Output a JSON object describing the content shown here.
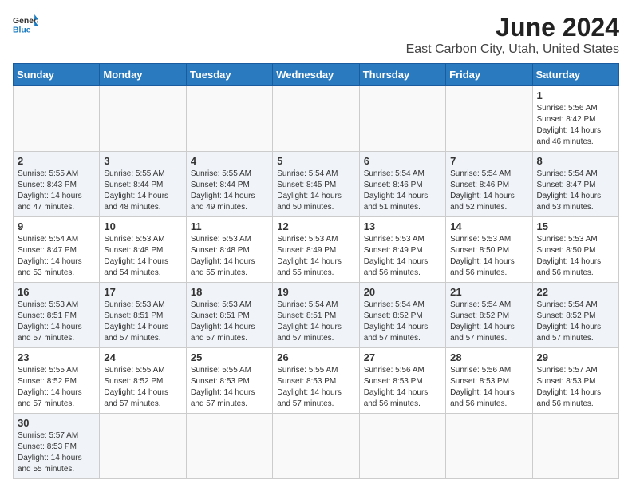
{
  "header": {
    "logo_general": "General",
    "logo_blue": "Blue",
    "month_title": "June 2024",
    "location": "East Carbon City, Utah, United States"
  },
  "weekdays": [
    "Sunday",
    "Monday",
    "Tuesday",
    "Wednesday",
    "Thursday",
    "Friday",
    "Saturday"
  ],
  "weeks": [
    [
      {
        "day": "",
        "info": ""
      },
      {
        "day": "",
        "info": ""
      },
      {
        "day": "",
        "info": ""
      },
      {
        "day": "",
        "info": ""
      },
      {
        "day": "",
        "info": ""
      },
      {
        "day": "",
        "info": ""
      },
      {
        "day": "1",
        "info": "Sunrise: 5:56 AM\nSunset: 8:42 PM\nDaylight: 14 hours\nand 46 minutes."
      }
    ],
    [
      {
        "day": "2",
        "info": "Sunrise: 5:55 AM\nSunset: 8:43 PM\nDaylight: 14 hours\nand 47 minutes."
      },
      {
        "day": "3",
        "info": "Sunrise: 5:55 AM\nSunset: 8:44 PM\nDaylight: 14 hours\nand 48 minutes."
      },
      {
        "day": "4",
        "info": "Sunrise: 5:55 AM\nSunset: 8:44 PM\nDaylight: 14 hours\nand 49 minutes."
      },
      {
        "day": "5",
        "info": "Sunrise: 5:54 AM\nSunset: 8:45 PM\nDaylight: 14 hours\nand 50 minutes."
      },
      {
        "day": "6",
        "info": "Sunrise: 5:54 AM\nSunset: 8:46 PM\nDaylight: 14 hours\nand 51 minutes."
      },
      {
        "day": "7",
        "info": "Sunrise: 5:54 AM\nSunset: 8:46 PM\nDaylight: 14 hours\nand 52 minutes."
      },
      {
        "day": "8",
        "info": "Sunrise: 5:54 AM\nSunset: 8:47 PM\nDaylight: 14 hours\nand 53 minutes."
      }
    ],
    [
      {
        "day": "9",
        "info": "Sunrise: 5:54 AM\nSunset: 8:47 PM\nDaylight: 14 hours\nand 53 minutes."
      },
      {
        "day": "10",
        "info": "Sunrise: 5:53 AM\nSunset: 8:48 PM\nDaylight: 14 hours\nand 54 minutes."
      },
      {
        "day": "11",
        "info": "Sunrise: 5:53 AM\nSunset: 8:48 PM\nDaylight: 14 hours\nand 55 minutes."
      },
      {
        "day": "12",
        "info": "Sunrise: 5:53 AM\nSunset: 8:49 PM\nDaylight: 14 hours\nand 55 minutes."
      },
      {
        "day": "13",
        "info": "Sunrise: 5:53 AM\nSunset: 8:49 PM\nDaylight: 14 hours\nand 56 minutes."
      },
      {
        "day": "14",
        "info": "Sunrise: 5:53 AM\nSunset: 8:50 PM\nDaylight: 14 hours\nand 56 minutes."
      },
      {
        "day": "15",
        "info": "Sunrise: 5:53 AM\nSunset: 8:50 PM\nDaylight: 14 hours\nand 56 minutes."
      }
    ],
    [
      {
        "day": "16",
        "info": "Sunrise: 5:53 AM\nSunset: 8:51 PM\nDaylight: 14 hours\nand 57 minutes."
      },
      {
        "day": "17",
        "info": "Sunrise: 5:53 AM\nSunset: 8:51 PM\nDaylight: 14 hours\nand 57 minutes."
      },
      {
        "day": "18",
        "info": "Sunrise: 5:53 AM\nSunset: 8:51 PM\nDaylight: 14 hours\nand 57 minutes."
      },
      {
        "day": "19",
        "info": "Sunrise: 5:54 AM\nSunset: 8:51 PM\nDaylight: 14 hours\nand 57 minutes."
      },
      {
        "day": "20",
        "info": "Sunrise: 5:54 AM\nSunset: 8:52 PM\nDaylight: 14 hours\nand 57 minutes."
      },
      {
        "day": "21",
        "info": "Sunrise: 5:54 AM\nSunset: 8:52 PM\nDaylight: 14 hours\nand 57 minutes."
      },
      {
        "day": "22",
        "info": "Sunrise: 5:54 AM\nSunset: 8:52 PM\nDaylight: 14 hours\nand 57 minutes."
      }
    ],
    [
      {
        "day": "23",
        "info": "Sunrise: 5:55 AM\nSunset: 8:52 PM\nDaylight: 14 hours\nand 57 minutes."
      },
      {
        "day": "24",
        "info": "Sunrise: 5:55 AM\nSunset: 8:52 PM\nDaylight: 14 hours\nand 57 minutes."
      },
      {
        "day": "25",
        "info": "Sunrise: 5:55 AM\nSunset: 8:53 PM\nDaylight: 14 hours\nand 57 minutes."
      },
      {
        "day": "26",
        "info": "Sunrise: 5:55 AM\nSunset: 8:53 PM\nDaylight: 14 hours\nand 57 minutes."
      },
      {
        "day": "27",
        "info": "Sunrise: 5:56 AM\nSunset: 8:53 PM\nDaylight: 14 hours\nand 56 minutes."
      },
      {
        "day": "28",
        "info": "Sunrise: 5:56 AM\nSunset: 8:53 PM\nDaylight: 14 hours\nand 56 minutes."
      },
      {
        "day": "29",
        "info": "Sunrise: 5:57 AM\nSunset: 8:53 PM\nDaylight: 14 hours\nand 56 minutes."
      }
    ],
    [
      {
        "day": "30",
        "info": "Sunrise: 5:57 AM\nSunset: 8:53 PM\nDaylight: 14 hours\nand 55 minutes."
      },
      {
        "day": "",
        "info": ""
      },
      {
        "day": "",
        "info": ""
      },
      {
        "day": "",
        "info": ""
      },
      {
        "day": "",
        "info": ""
      },
      {
        "day": "",
        "info": ""
      },
      {
        "day": "",
        "info": ""
      }
    ]
  ]
}
